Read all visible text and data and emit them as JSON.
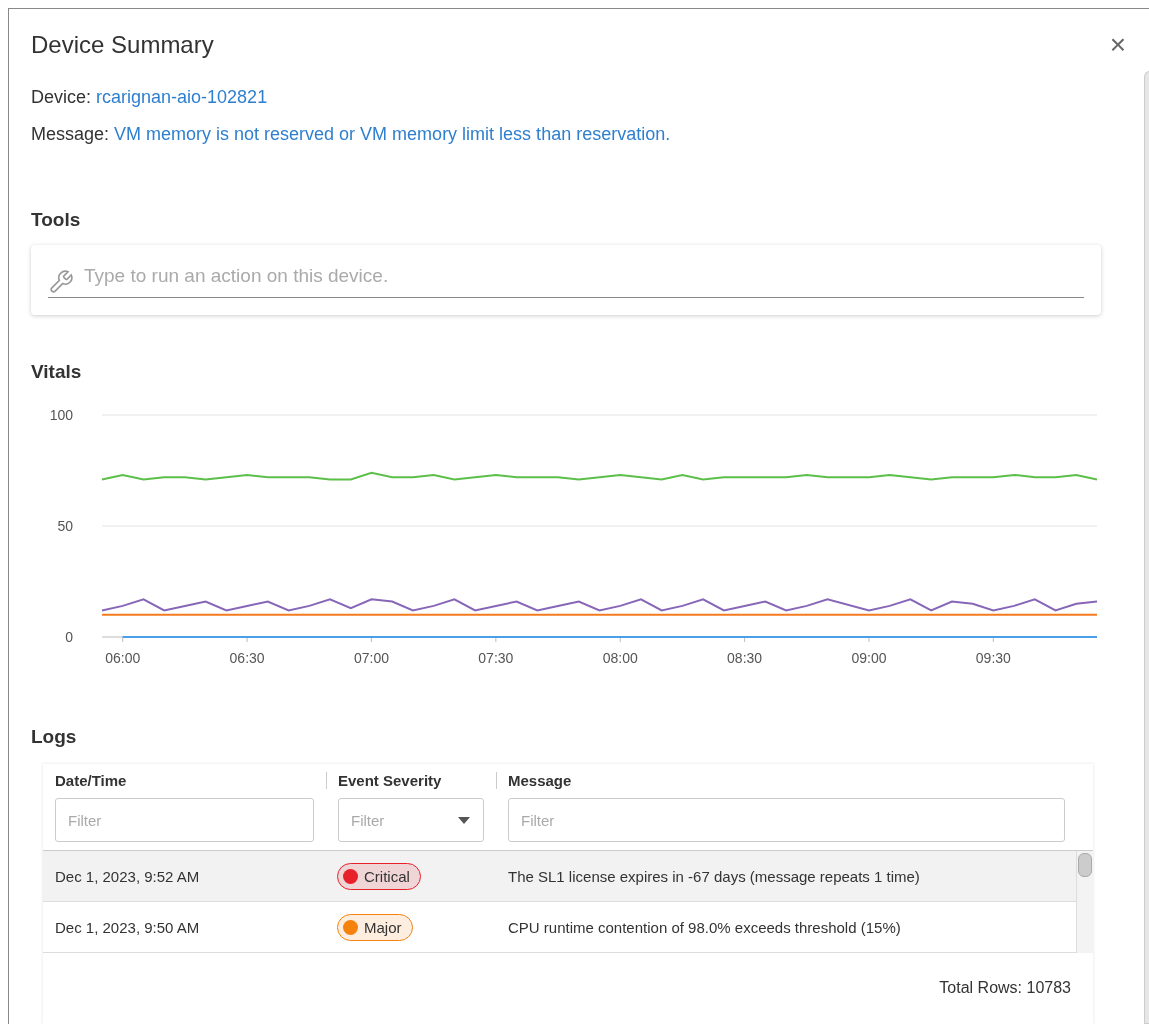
{
  "dialog": {
    "title": "Device Summary",
    "close": "×"
  },
  "fields": [
    {
      "label": "Device:",
      "value": "rcarignan-aio-102821"
    },
    {
      "label": "Message:",
      "value": "VM memory is not reserved or VM memory limit less than reservation."
    }
  ],
  "tools": {
    "heading": "Tools",
    "placeholder": "Type to run an action on this device."
  },
  "vitals": {
    "heading": "Vitals",
    "chart_data": {
      "type": "line",
      "x": [
        355,
        360,
        365,
        370,
        375,
        380,
        385,
        390,
        395,
        400,
        405,
        410,
        415,
        420,
        425,
        430,
        435,
        440,
        445,
        450,
        455,
        460,
        465,
        470,
        475,
        480,
        485,
        490,
        495,
        500,
        505,
        510,
        515,
        520,
        525,
        530,
        540,
        545,
        550,
        555,
        560,
        565,
        570,
        575,
        580,
        585,
        590,
        595
      ],
      "xlim": [
        355,
        595
      ],
      "ylim": [
        0,
        100
      ],
      "yticks": [
        0,
        50,
        100
      ],
      "xticks": [
        {
          "value": 360,
          "label": "06:00"
        },
        {
          "value": 390,
          "label": "06:30"
        },
        {
          "value": 420,
          "label": "07:00"
        },
        {
          "value": 450,
          "label": "07:30"
        },
        {
          "value": 480,
          "label": "08:00"
        },
        {
          "value": 510,
          "label": "08:30"
        },
        {
          "value": 540,
          "label": "09:00"
        },
        {
          "value": 570,
          "label": "09:30"
        }
      ],
      "series": [
        {
          "color": "#5cbf4a",
          "values": [
            71,
            73,
            71,
            72,
            72,
            71,
            72,
            73,
            72,
            72,
            72,
            71,
            71,
            74,
            72,
            72,
            73,
            71,
            72,
            73,
            72,
            72,
            72,
            71,
            72,
            73,
            72,
            71,
            73,
            71,
            72,
            72,
            72,
            72,
            73,
            72,
            72,
            73,
            72,
            71,
            72,
            72,
            72,
            73,
            72,
            72,
            73,
            71
          ]
        },
        {
          "color": "#8766b8",
          "values": [
            12,
            14,
            17,
            12,
            14,
            16,
            12,
            14,
            16,
            12,
            14,
            17,
            13,
            17,
            16,
            12,
            14,
            17,
            12,
            14,
            16,
            12,
            14,
            16,
            12,
            14,
            17,
            12,
            14,
            17,
            12,
            14,
            16,
            12,
            14,
            17,
            12,
            14,
            17,
            12,
            16,
            15,
            12,
            14,
            17,
            12,
            15,
            16
          ]
        },
        {
          "color": "#f47a1f",
          "values": [
            10,
            10,
            10,
            10,
            10,
            10,
            10,
            10,
            10,
            10,
            10,
            10,
            10,
            10,
            10,
            10,
            10,
            10,
            10,
            10,
            10,
            10,
            10,
            10,
            10,
            10,
            10,
            10,
            10,
            10,
            10,
            10,
            10,
            10,
            10,
            10,
            10,
            10,
            10,
            10,
            10,
            10,
            10,
            10,
            10,
            10,
            10,
            10
          ]
        },
        {
          "color": "#4a9fe8",
          "values": [
            null,
            0,
            0,
            0,
            0,
            0,
            0,
            0,
            0,
            0,
            0,
            0,
            0,
            0,
            0,
            0,
            0,
            0,
            0,
            0,
            0,
            0,
            0,
            0,
            0,
            0,
            0,
            0,
            0,
            0,
            0,
            0,
            0,
            0,
            0,
            0,
            0,
            0,
            0,
            0,
            0,
            0,
            0,
            0,
            0,
            0,
            0,
            0
          ]
        }
      ]
    }
  },
  "logs": {
    "heading": "Logs",
    "columns": [
      {
        "label": "Date/Time",
        "filter": {
          "kind": "text",
          "placeholder": "Filter"
        }
      },
      {
        "label": "Event Severity",
        "filter": {
          "kind": "select",
          "placeholder": "Filter"
        }
      },
      {
        "label": "Message",
        "filter": {
          "kind": "text",
          "placeholder": "Filter"
        }
      }
    ],
    "rows": [
      {
        "time": "Dec 1, 2023, 9:52 AM",
        "severity": "Critical",
        "color": "#e8202a",
        "message": "The SL1 license expires in -67 days (message repeats 1 time)",
        "selected": true
      },
      {
        "time": "Dec 1, 2023, 9:50 AM",
        "severity": "Major",
        "color": "#f5820d",
        "message": "CPU runtime contention of 98.0% exceeds threshold (15%)",
        "selected": false
      }
    ],
    "total": "Total Rows: 10783"
  }
}
